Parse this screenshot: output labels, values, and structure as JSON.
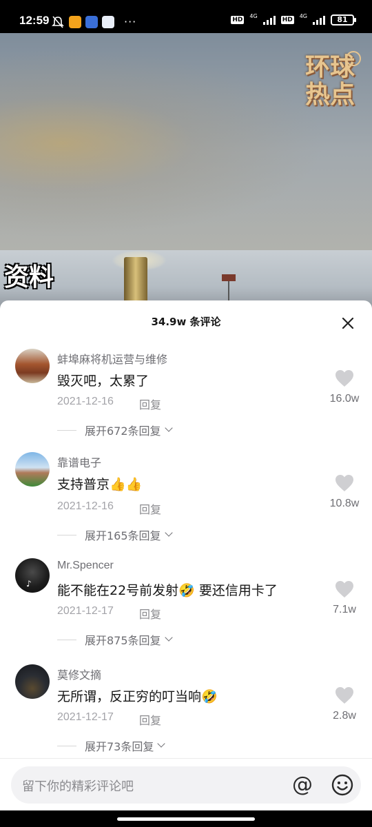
{
  "status_bar": {
    "time": "12:59",
    "network_1": "4G",
    "network_2": "4G",
    "hd_badge": "HD",
    "battery": "81",
    "more": "···"
  },
  "video": {
    "caption": "资料",
    "logo_line1": "环球",
    "logo_line2": "热点"
  },
  "sheet": {
    "title": "34.9w 条评论",
    "close_icon": "close-icon"
  },
  "comments": [
    {
      "username": "蚌埠麻将机运营与维修",
      "content": "毁灭吧，太累了",
      "date": "2021-12-16",
      "reply": "回复",
      "expand": "展开672条回复",
      "likes": "16.0w"
    },
    {
      "username": "靠谱电子",
      "content": "支持普京👍👍",
      "date": "2021-12-16",
      "reply": "回复",
      "expand": "展开165条回复",
      "likes": "10.8w"
    },
    {
      "username": "Mr.Spencer",
      "content": "能不能在22号前发射🤣 要还信用卡了",
      "date": "2021-12-17",
      "reply": "回复",
      "expand": "展开875条回复",
      "likes": "7.1w"
    },
    {
      "username": "莫修文摘",
      "content": "无所谓，反正穷的叮当响🤣",
      "date": "2021-12-17",
      "reply": "回复",
      "expand": "展开73条回复",
      "likes": "2.8w"
    }
  ],
  "input": {
    "placeholder": "留下你的精彩评论吧",
    "at_label": "@"
  }
}
